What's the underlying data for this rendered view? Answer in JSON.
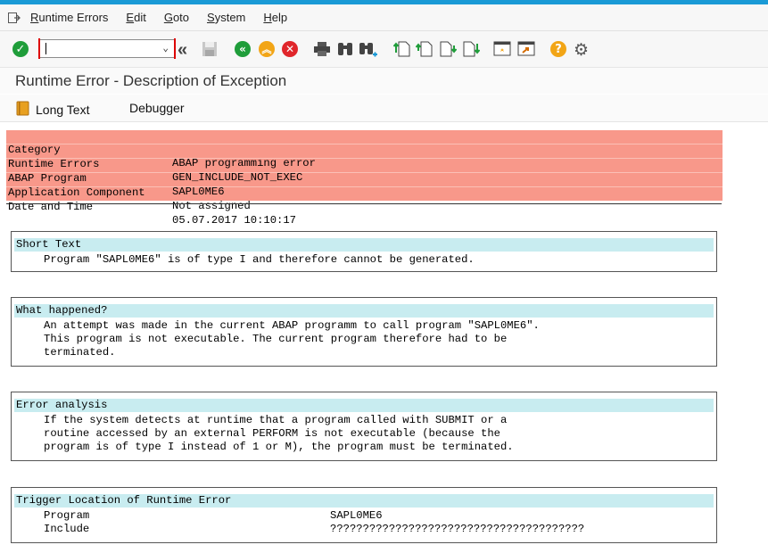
{
  "menu": {
    "items": [
      "Runtime Errors",
      "Edit",
      "Goto",
      "System",
      "Help"
    ]
  },
  "toolbar": {
    "command_value": "",
    "icons": [
      "enter-icon",
      "back-icon",
      "save-icon",
      "back-nav-icon",
      "exit-icon",
      "cancel-icon",
      "print-icon",
      "find-icon",
      "find-next-icon",
      "first-page-icon",
      "previous-page-icon",
      "next-page-icon",
      "last-page-icon",
      "create-session-icon",
      "shortcut-icon",
      "help-icon",
      "settings-icon"
    ]
  },
  "title": "Runtime Error - Description of Exception",
  "appbar": {
    "long_text_label": "Long Text",
    "debugger_label": "Debugger"
  },
  "header": {
    "rows": [
      {
        "key": "Category",
        "value": "ABAP programming error"
      },
      {
        "key": "Runtime Errors",
        "value": "GEN_INCLUDE_NOT_EXEC"
      },
      {
        "key": "ABAP Program",
        "value": "SAPL0ME6"
      },
      {
        "key": "Application Component",
        "value": "Not assigned"
      },
      {
        "key": "Date and Time",
        "value": "05.07.2017 10:10:17"
      }
    ]
  },
  "sections": {
    "short_text": {
      "heading": "Short Text",
      "lines": [
        "Program \"SAPL0ME6\" is of type I and therefore cannot be generated."
      ]
    },
    "what_happened": {
      "heading": "What happened?",
      "lines": [
        "An attempt was made in the current ABAP programm to call program \"SAPL0ME6\".",
        "This program is not executable. The current program therefore had to be",
        "terminated."
      ]
    },
    "error_analysis": {
      "heading": "Error analysis",
      "lines": [
        "If the system detects at runtime that a program called with SUBMIT or a",
        "routine accessed by an external PERFORM is not executable (because the",
        "program is of type I instead of 1 or M), the program must be terminated."
      ]
    },
    "trigger_location": {
      "heading": "Trigger Location of Runtime Error",
      "rows": [
        {
          "key": "Program",
          "value": "SAPL0ME6"
        },
        {
          "key": "Include",
          "value": "???????????????????????????????????????"
        }
      ]
    }
  },
  "colors": {
    "header_bg": "#f8988a",
    "section_heading_bg": "#c8ecf0",
    "enter_green": "#1f9d3a",
    "nav_green": "#1f9d3a",
    "exit_orange": "#f2a516",
    "cancel_red": "#e0262b",
    "help_orange": "#f2a516",
    "accent_blue": "#1a9ad6"
  }
}
